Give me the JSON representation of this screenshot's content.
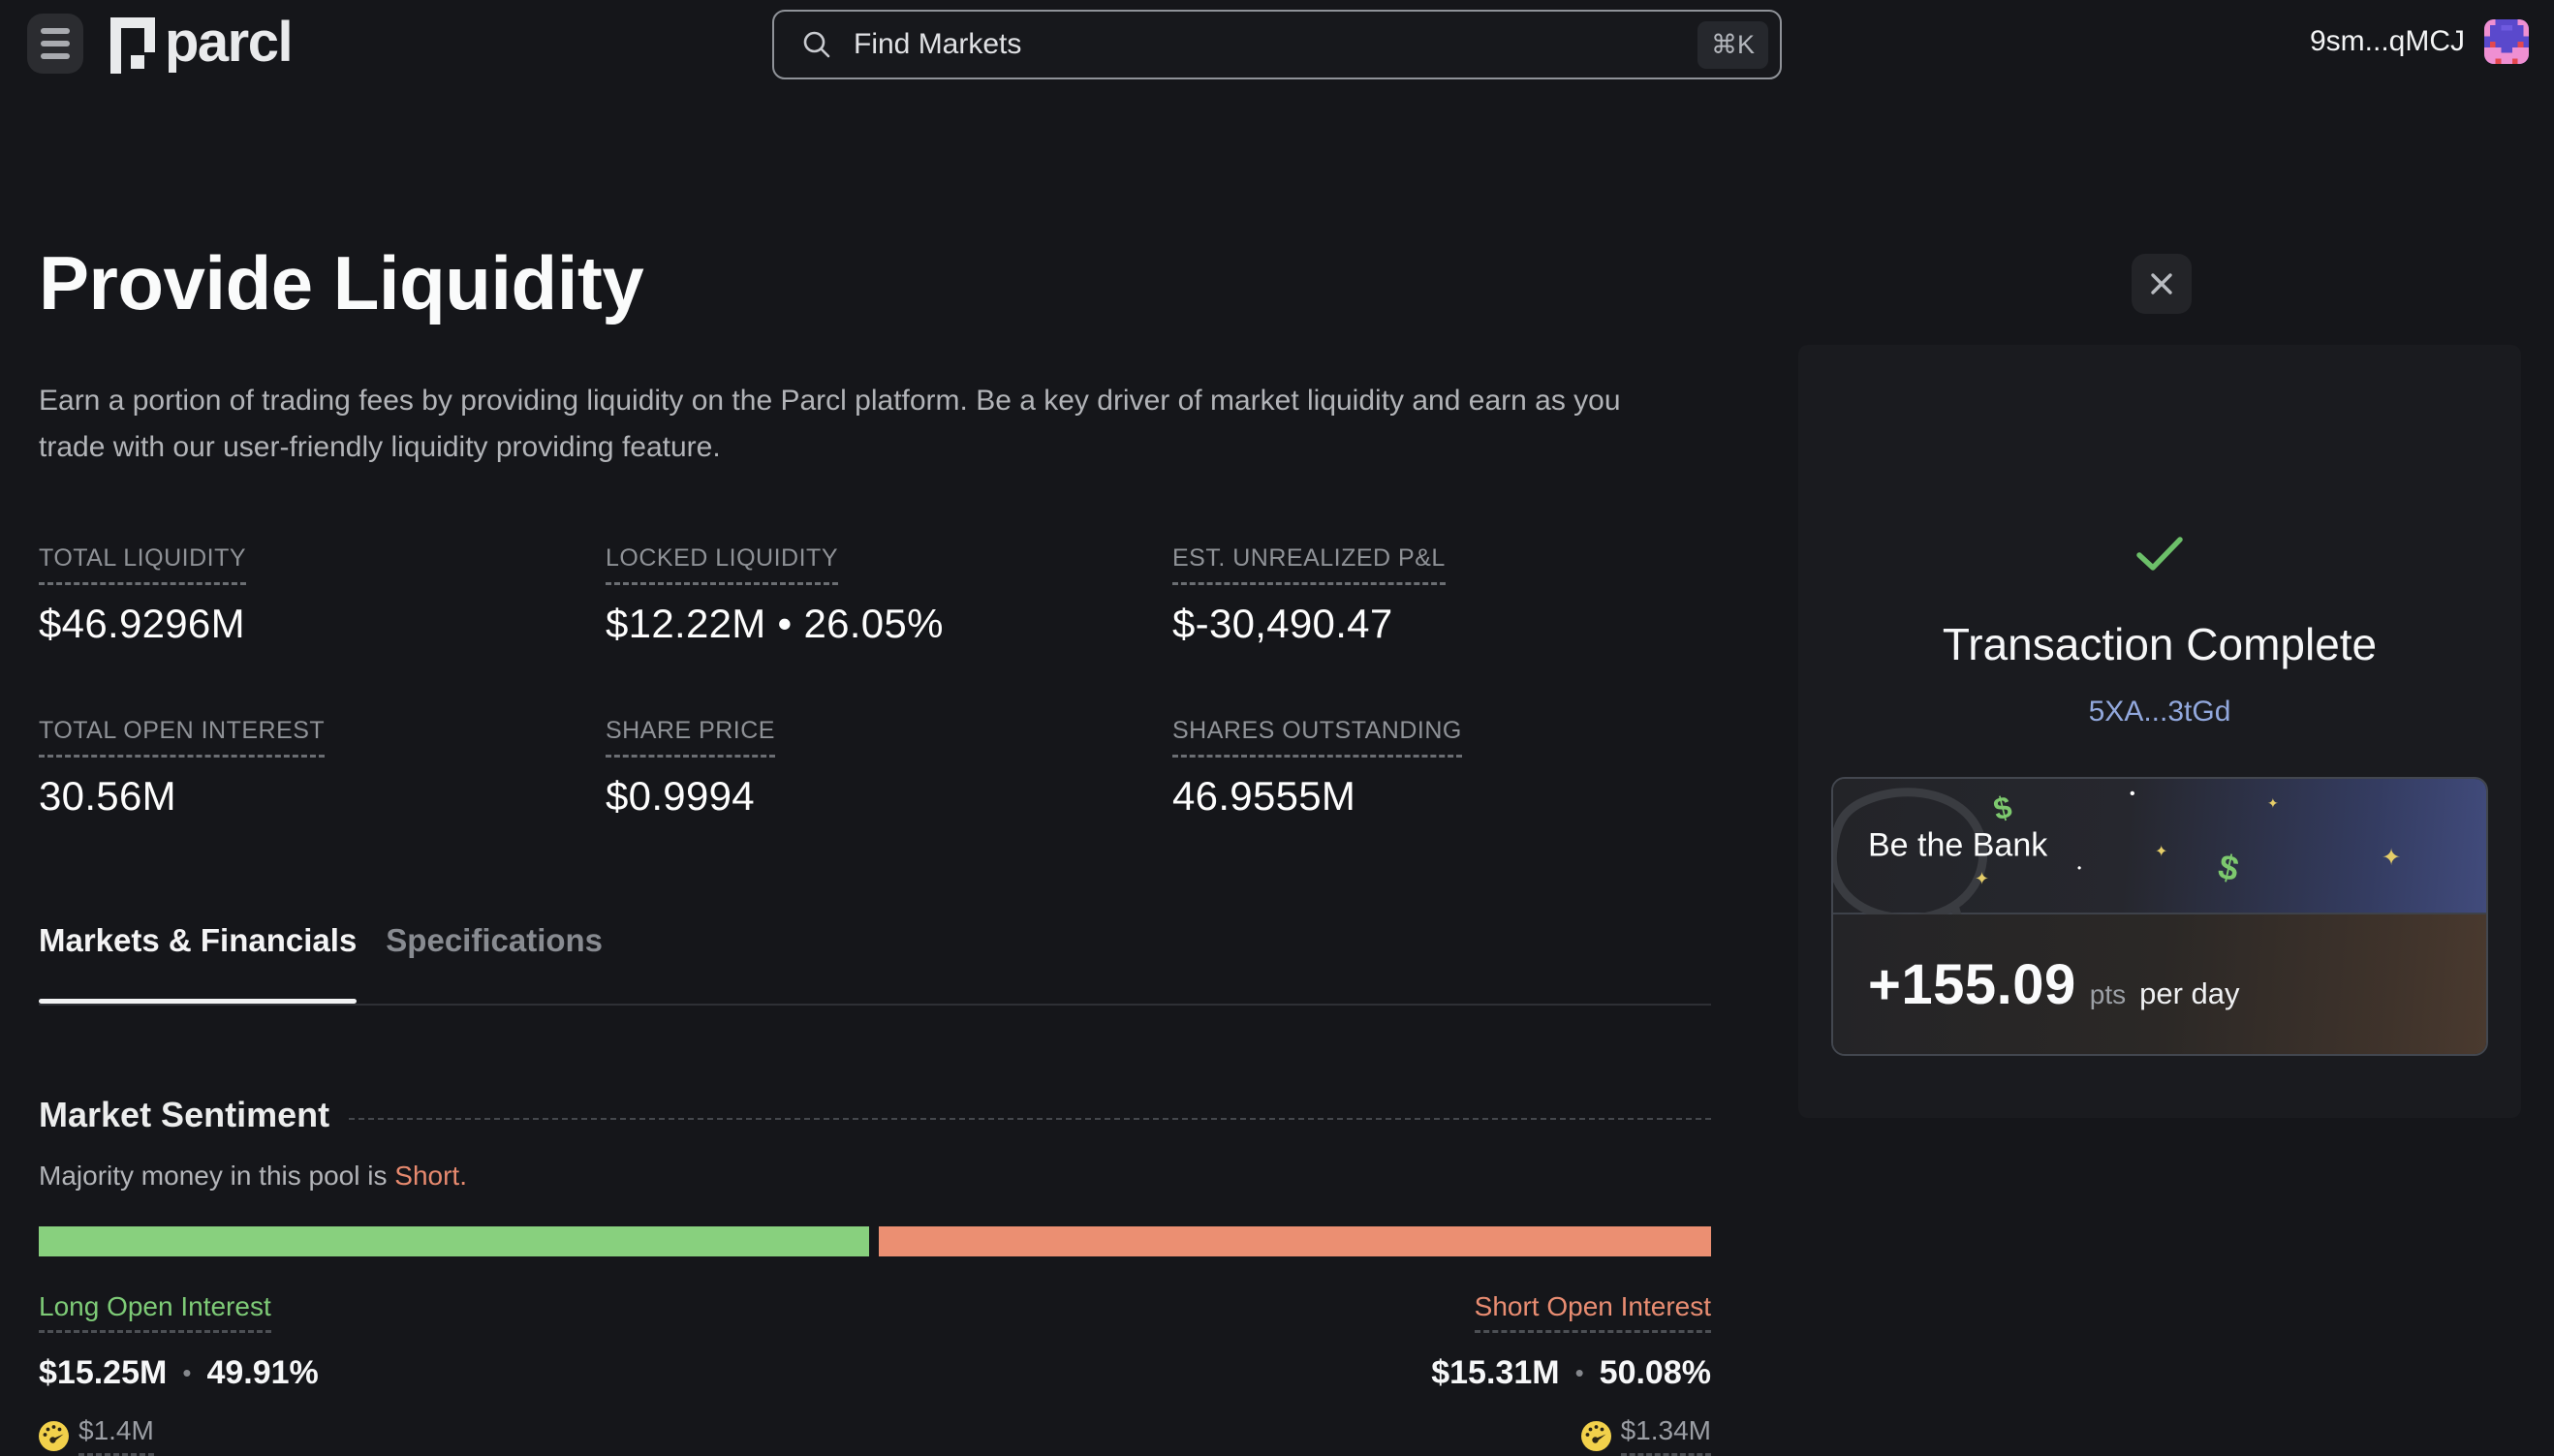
{
  "topbar": {
    "logo_text": "parcl",
    "search": {
      "placeholder": "Find Markets",
      "shortcut": "⌘K"
    },
    "wallet_address": "9sm...qMCJ"
  },
  "page": {
    "title": "Provide Liquidity",
    "description": "Earn a portion of trading fees by providing liquidity on the Parcl platform. Be a key driver of market liquidity and earn as you trade with our user-friendly liquidity providing feature."
  },
  "stats": [
    {
      "label": "TOTAL LIQUIDITY",
      "value": "$46.9296M"
    },
    {
      "label": "LOCKED LIQUIDITY",
      "value": "$12.22M • 26.05%"
    },
    {
      "label": "EST. UNREALIZED P&L",
      "value": "$-30,490.47"
    },
    {
      "label": "TOTAL OPEN INTEREST",
      "value": "30.56M"
    },
    {
      "label": "SHARE PRICE",
      "value": "$0.9994"
    },
    {
      "label": "SHARES OUTSTANDING",
      "value": "46.9555M"
    }
  ],
  "tabs": [
    {
      "label": "Markets & Financials"
    },
    {
      "label": "Specifications"
    }
  ],
  "sentiment": {
    "heading": "Market Sentiment",
    "summary_prefix": "Majority money in this pool is ",
    "summary_highlight": "Short.",
    "bar": {
      "long_pct": 49.91,
      "short_pct": 50.08,
      "long_color": "#88d07e",
      "short_color": "#eb8f72"
    },
    "long": {
      "label": "Long Open Interest",
      "value": "$15.25M",
      "separator": "•",
      "percent": "49.91%",
      "boost": "$1.4M"
    },
    "short": {
      "label": "Short Open Interest",
      "value": "$15.31M",
      "separator": "•",
      "percent": "50.08%",
      "boost": "$1.34M"
    }
  },
  "transaction_panel": {
    "status_title": "Transaction Complete",
    "tx_hash": "5XA...3tGd",
    "promo_card": {
      "title": "Be the Bank",
      "points": "+155.09",
      "points_unit": "pts",
      "points_suffix": "per day",
      "decorations": {
        "dollar": "$",
        "sparkle": "✦",
        "dot": "•"
      }
    }
  },
  "colors": {
    "long_green": "#88d07e",
    "short_salmon": "#eb8f72",
    "link_blue": "#92a8dd",
    "check_green": "#6cc069",
    "gauge_yellow": "#f2d14b"
  }
}
